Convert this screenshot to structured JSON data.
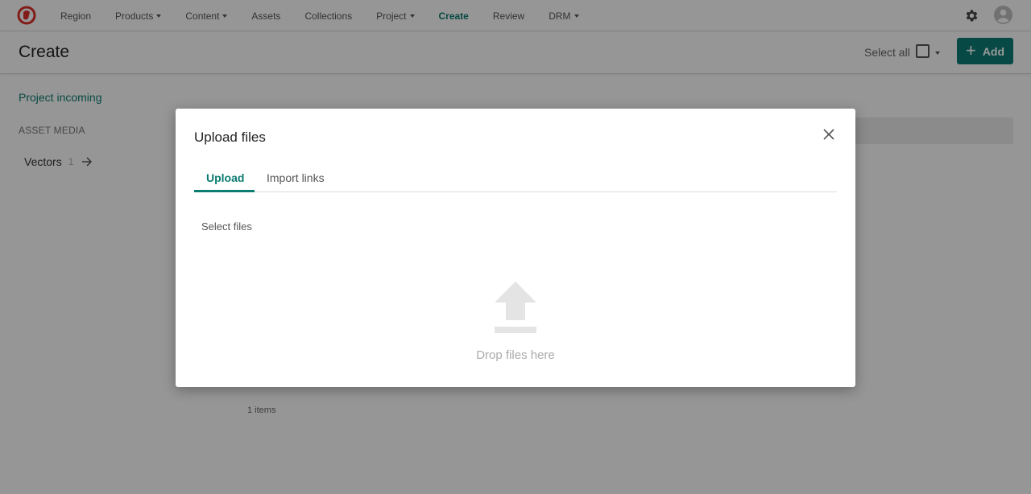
{
  "nav": {
    "items": [
      {
        "label": "Region",
        "caret": false,
        "active": false
      },
      {
        "label": "Products",
        "caret": true,
        "active": false
      },
      {
        "label": "Content",
        "caret": true,
        "active": false
      },
      {
        "label": "Assets",
        "caret": false,
        "active": false
      },
      {
        "label": "Collections",
        "caret": false,
        "active": false
      },
      {
        "label": "Project",
        "caret": true,
        "active": false
      },
      {
        "label": "Create",
        "caret": false,
        "active": true
      },
      {
        "label": "Review",
        "caret": false,
        "active": false
      },
      {
        "label": "DRM",
        "caret": true,
        "active": false
      }
    ],
    "icons": {
      "logo": "brand-logo-icon",
      "settings": "gear-icon",
      "profile": "user-avatar-icon"
    }
  },
  "header": {
    "title": "Create",
    "select_all_label": "Select all",
    "add_label": "Add"
  },
  "sidebar": {
    "project_link": "Project incoming",
    "section_label": "ASSET MEDIA",
    "items": [
      {
        "label": "Vectors",
        "count": "1"
      }
    ]
  },
  "main": {
    "items_count": "1 items"
  },
  "modal": {
    "title": "Upload files",
    "tabs": [
      {
        "label": "Upload",
        "active": true
      },
      {
        "label": "Import links",
        "active": false
      }
    ],
    "select_files_label": "Select files",
    "drop_text": "Drop files here"
  },
  "colors": {
    "accent": "#0c7b72",
    "logo_red": "#d9302a"
  }
}
